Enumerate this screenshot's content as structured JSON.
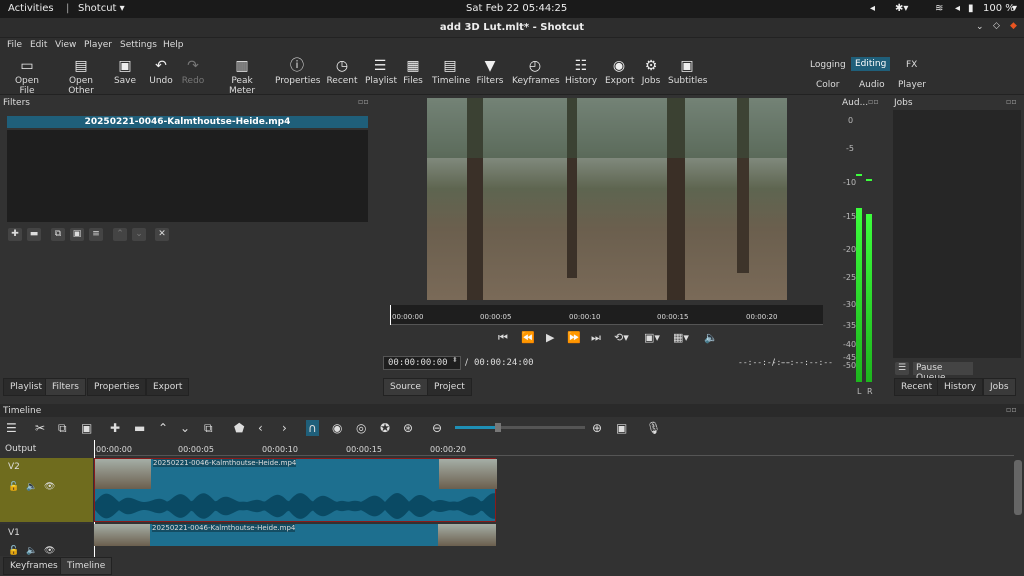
{
  "system_bar": {
    "activities": "Activities",
    "app": "Shotcut",
    "clock": "Sat Feb 22  05:44:25",
    "battery": "100 %"
  },
  "window": {
    "title": "add 3D Lut.mlt* - Shotcut"
  },
  "menu": [
    "File",
    "Edit",
    "View",
    "Player",
    "Settings",
    "Help"
  ],
  "toolbar": {
    "open_file": "Open File",
    "open_other": "Open Other",
    "save": "Save",
    "undo": "Undo",
    "redo": "Redo",
    "peak_meter": "Peak Meter",
    "properties": "Properties",
    "recent": "Recent",
    "playlist": "Playlist",
    "files": "Files",
    "timeline": "Timeline",
    "filters": "Filters",
    "keyframes": "Keyframes",
    "history": "History",
    "export": "Export",
    "jobs": "Jobs",
    "subtitles": "Subtitles"
  },
  "workspaces": {
    "logging": "Logging",
    "editing": "Editing",
    "fx": "FX",
    "color": "Color",
    "audio": "Audio",
    "player": "Player"
  },
  "filters_panel": {
    "title": "Filters",
    "clip": "20250221-0046-Kalmthoutse-Heide.mp4"
  },
  "left_tabs": {
    "playlist": "Playlist",
    "filters": "Filters",
    "properties": "Properties",
    "export": "Export"
  },
  "player": {
    "ruler": [
      "00:00:00",
      "00:00:05",
      "00:00:10",
      "00:00:15",
      "00:00:20"
    ],
    "position": "00:00:00:00",
    "separator": "/",
    "duration": "00:00:24:00",
    "in_point": "--:--:--:--",
    "out_point": "--:--:--:--",
    "source_tab": "Source",
    "project_tab": "Project"
  },
  "audio_panel": {
    "title": "Aud...",
    "scale": [
      "0",
      "-5",
      "-10",
      "-15",
      "-20",
      "-25",
      "-30",
      "-35",
      "-40",
      "-45",
      "-50"
    ],
    "left": "L",
    "right": "R",
    "left_level": 0.84,
    "right_level": 0.81
  },
  "jobs_panel": {
    "title": "Jobs",
    "pause_queue": "Pause Queue",
    "tabs": {
      "recent": "Recent",
      "history": "History",
      "jobs": "Jobs"
    }
  },
  "timeline": {
    "title": "Timeline",
    "output": "Output",
    "ruler": [
      "00:00:00",
      "00:00:05",
      "00:00:10",
      "00:00:15",
      "00:00:20"
    ],
    "tracks": [
      {
        "name": "V2",
        "clip": "20250221-0046-Kalmthoutse-Heide.mp4"
      },
      {
        "name": "V1",
        "clip": "20250221-0046-Kalmthoutse-Heide.mp4"
      }
    ]
  },
  "bottom_tabs": {
    "keyframes": "Keyframes",
    "timeline": "Timeline"
  }
}
